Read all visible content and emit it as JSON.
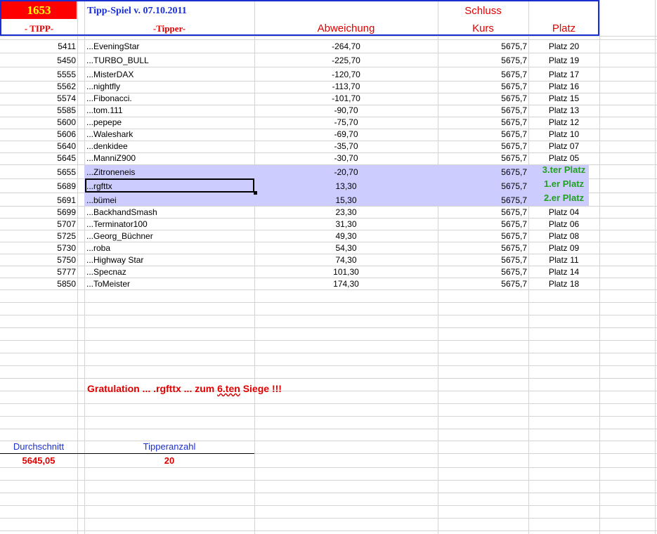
{
  "header": {
    "number": "1653",
    "title": "Tipp-Spiel v. 07.10.2011",
    "col_tipp": "- TIPP-",
    "col_tipper": "-Tipper-",
    "col_abweichung": "Abweichung",
    "col_schluss": "Schluss",
    "col_kurs": "Kurs",
    "col_platz": "Platz"
  },
  "rows": [
    {
      "tipp": "5411",
      "tipper": "...EveningStar",
      "abw": "-264,70",
      "kurs": "5675,7",
      "platz": "Platz 20"
    },
    {
      "tipp": "5450",
      "tipper": "...TURBO_BULL",
      "abw": "-225,70",
      "kurs": "5675,7",
      "platz": "Platz 19"
    },
    {
      "tipp": "5555",
      "tipper": "...MisterDAX",
      "abw": "-120,70",
      "kurs": "5675,7",
      "platz": "Platz 17"
    },
    {
      "tipp": "5562",
      "tipper": "...nightfly",
      "abw": "-113,70",
      "kurs": "5675,7",
      "platz": "Platz 16"
    },
    {
      "tipp": "5574",
      "tipper": "...Fibonacci.",
      "abw": "-101,70",
      "kurs": "5675,7",
      "platz": "Platz 15"
    },
    {
      "tipp": "5585",
      "tipper": "...tom.111",
      "abw": "-90,70",
      "kurs": "5675,7",
      "platz": "Platz 13"
    },
    {
      "tipp": "5600",
      "tipper": "...pepepe",
      "abw": "-75,70",
      "kurs": "5675,7",
      "platz": "Platz 12"
    },
    {
      "tipp": "5606",
      "tipper": "...Waleshark",
      "abw": "-69,70",
      "kurs": "5675,7",
      "platz": "Platz 10"
    },
    {
      "tipp": "5640",
      "tipper": "...denkidee",
      "abw": "-35,70",
      "kurs": "5675,7",
      "platz": "Platz 07"
    },
    {
      "tipp": "5645",
      "tipper": "...ManniZ900",
      "abw": "-30,70",
      "kurs": "5675,7",
      "platz": "Platz 05"
    },
    {
      "tipp": "5655",
      "tipper": "...Zitroneneis",
      "abw": "-20,70",
      "kurs": "5675,7",
      "platz": "3.ter Platz"
    },
    {
      "tipp": "5689",
      "tipper": "...rgfttx",
      "abw": "13,30",
      "kurs": "5675,7",
      "platz": "1.er Platz"
    },
    {
      "tipp": "5691",
      "tipper": "...bümei",
      "abw": "15,30",
      "kurs": "5675,7",
      "platz": "2.er Platz"
    },
    {
      "tipp": "5699",
      "tipper": "...BackhandSmash",
      "abw": "23,30",
      "kurs": "5675,7",
      "platz": "Platz 04"
    },
    {
      "tipp": "5707",
      "tipper": "...Terminator100",
      "abw": "31,30",
      "kurs": "5675,7",
      "platz": "Platz 06"
    },
    {
      "tipp": "5725",
      "tipper": "...Georg_Büchner",
      "abw": "49,30",
      "kurs": "5675,7",
      "platz": "Platz 08"
    },
    {
      "tipp": "5730",
      "tipper": "...roba",
      "abw": "54,30",
      "kurs": "5675,7",
      "platz": "Platz 09"
    },
    {
      "tipp": "5750",
      "tipper": "...Highway Star",
      "abw": "74,30",
      "kurs": "5675,7",
      "platz": "Platz 11"
    },
    {
      "tipp": "5777",
      "tipper": "...Specnaz",
      "abw": "101,30",
      "kurs": "5675,7",
      "platz": "Platz 14"
    },
    {
      "tipp": "5850",
      "tipper": "...ToMeister",
      "abw": "174,30",
      "kurs": "5675,7",
      "platz": "Platz 18"
    }
  ],
  "congrats": {
    "part1": "Gratulation ...  .rgfttx ...  zum  ",
    "part2": "6.ten",
    "part3": " Siege !!!"
  },
  "summary": {
    "durchschnitt_label": "Durchschnitt",
    "durchschnitt_value": "5645,05",
    "tipperanzahl_label": "Tipperanzahl",
    "tipperanzahl_value": "20"
  },
  "colors": {
    "header_border": "#1a2fd0",
    "header_red": "#e00000",
    "highlight": "#ccccff",
    "podium_green": "#22a022",
    "number_yellow": "#ffff00"
  }
}
